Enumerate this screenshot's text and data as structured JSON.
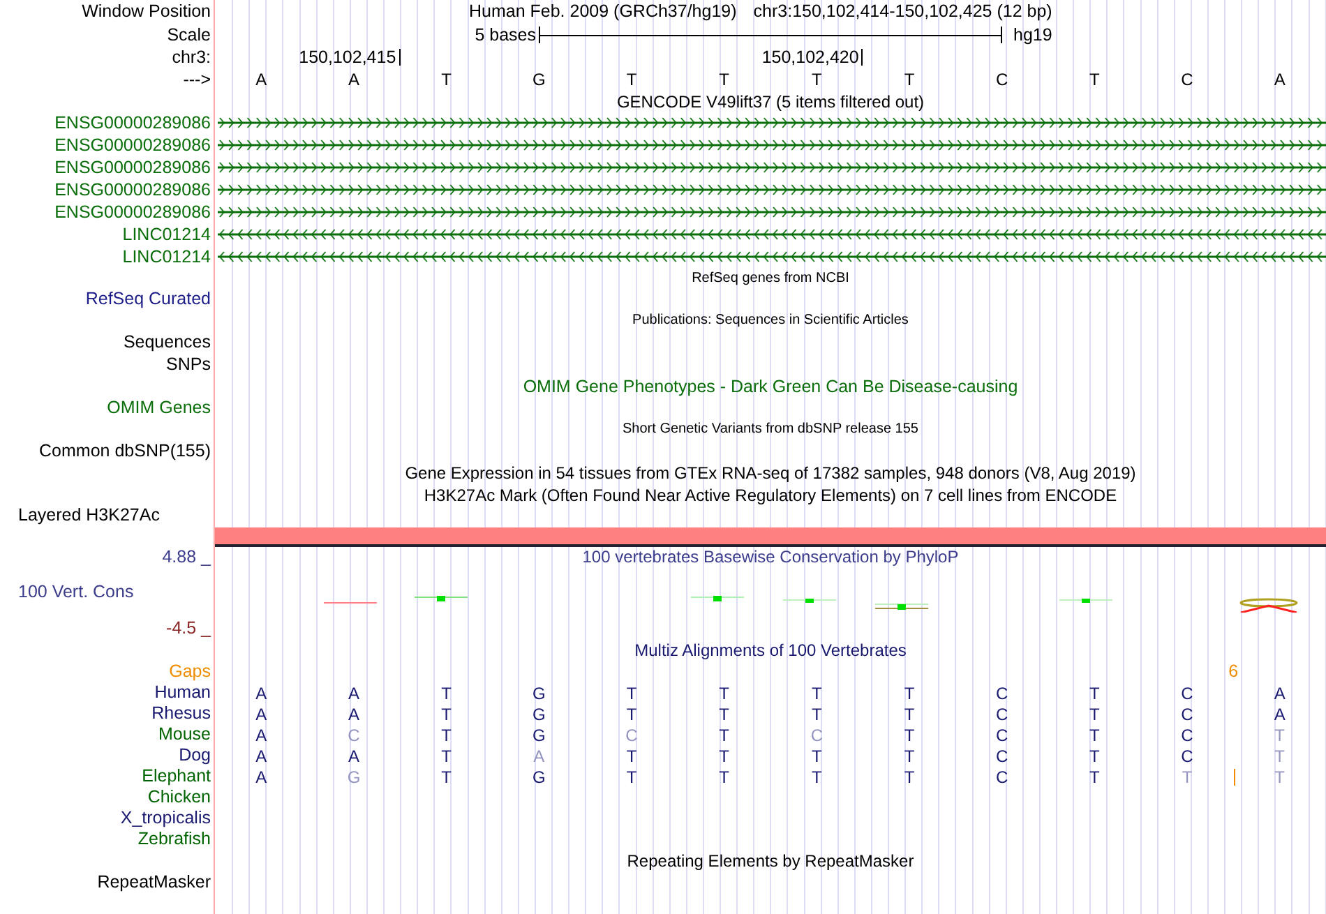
{
  "position": {
    "label": "Window Position",
    "assembly": "Human Feb. 2009 (GRCh37/hg19)",
    "range": "chr3:150,102,414-150,102,425 (12 bp)"
  },
  "scale": {
    "label": "Scale",
    "length": "5 bases",
    "assembly": "hg19"
  },
  "coordinates": {
    "label": "chr3:",
    "ticks": [
      "150,102,415",
      "150,102,420"
    ]
  },
  "sequence": {
    "label": "--->",
    "bases": [
      "A",
      "A",
      "T",
      "G",
      "T",
      "T",
      "T",
      "T",
      "C",
      "T",
      "C",
      "A"
    ]
  },
  "gencode": {
    "title": "GENCODE V49lift37 (5 items filtered out)",
    "genes": [
      {
        "name": "ENSG00000289086",
        "kind": "forward"
      },
      {
        "name": "ENSG00000289086",
        "kind": "forward"
      },
      {
        "name": "ENSG00000289086",
        "kind": "forward"
      },
      {
        "name": "ENSG00000289086",
        "kind": "forward"
      },
      {
        "name": "ENSG00000289086",
        "kind": "forward"
      },
      {
        "name": "LINC01214",
        "kind": "reverse"
      },
      {
        "name": "LINC01214",
        "kind": "reverse"
      }
    ]
  },
  "refseq": {
    "title": "RefSeq genes from NCBI",
    "label": "RefSeq Curated"
  },
  "publications": {
    "title": "Publications: Sequences in Scientific Articles",
    "labels": [
      "Sequences",
      "SNPs"
    ]
  },
  "omim": {
    "title": "OMIM Gene Phenotypes - Dark Green Can Be Disease-causing",
    "label": "OMIM Genes"
  },
  "dbsnp": {
    "title": "Short Genetic Variants from dbSNP release 155",
    "label": "Common dbSNP(155)"
  },
  "gtex": {
    "title": "Gene Expression in 54 tissues from GTEx RNA-seq of 17382 samples, 948 donors (V8, Aug 2019)"
  },
  "h3k27ac": {
    "title": "H3K27Ac Mark (Often Found Near Active Regulatory Elements) on 7 cell lines from ENCODE",
    "label": "Layered H3K27Ac"
  },
  "phylop": {
    "title": "100 vertebrates Basewise Conservation by PhyloP",
    "label": "100 Vert. Cons",
    "max": "4.88 _",
    "min": "-4.5 _"
  },
  "multiz": {
    "title": "Multiz Alignments of 100 Vertebrates",
    "gaps": {
      "label": "Gaps",
      "count": "6"
    },
    "species": [
      {
        "name": "Human",
        "color": "#191970",
        "insertion": false,
        "bases": [
          {
            "base": "A",
            "faded": false
          },
          {
            "base": "A",
            "faded": false
          },
          {
            "base": "T",
            "faded": false
          },
          {
            "base": "G",
            "faded": false
          },
          {
            "base": "T",
            "faded": false
          },
          {
            "base": "T",
            "faded": false
          },
          {
            "base": "T",
            "faded": false
          },
          {
            "base": "T",
            "faded": false
          },
          {
            "base": "C",
            "faded": false
          },
          {
            "base": "T",
            "faded": false
          },
          {
            "base": "C",
            "faded": false
          },
          {
            "base": "A",
            "faded": false
          }
        ]
      },
      {
        "name": "Rhesus",
        "color": "#191970",
        "insertion": false,
        "bases": [
          {
            "base": "A",
            "faded": false
          },
          {
            "base": "A",
            "faded": false
          },
          {
            "base": "T",
            "faded": false
          },
          {
            "base": "G",
            "faded": false
          },
          {
            "base": "T",
            "faded": false
          },
          {
            "base": "T",
            "faded": false
          },
          {
            "base": "T",
            "faded": false
          },
          {
            "base": "T",
            "faded": false
          },
          {
            "base": "C",
            "faded": false
          },
          {
            "base": "T",
            "faded": false
          },
          {
            "base": "C",
            "faded": false
          },
          {
            "base": "A",
            "faded": false
          }
        ]
      },
      {
        "name": "Mouse",
        "color": "#006400",
        "insertion": false,
        "bases": [
          {
            "base": "A",
            "faded": false
          },
          {
            "base": "C",
            "faded": true
          },
          {
            "base": "T",
            "faded": false
          },
          {
            "base": "G",
            "faded": false
          },
          {
            "base": "C",
            "faded": true
          },
          {
            "base": "T",
            "faded": false
          },
          {
            "base": "C",
            "faded": true
          },
          {
            "base": "T",
            "faded": false
          },
          {
            "base": "C",
            "faded": false
          },
          {
            "base": "T",
            "faded": false
          },
          {
            "base": "C",
            "faded": false
          },
          {
            "base": "T",
            "faded": true
          }
        ]
      },
      {
        "name": "Dog",
        "color": "#191970",
        "insertion": false,
        "bases": [
          {
            "base": "A",
            "faded": false
          },
          {
            "base": "A",
            "faded": false
          },
          {
            "base": "T",
            "faded": false
          },
          {
            "base": "A",
            "faded": true
          },
          {
            "base": "T",
            "faded": false
          },
          {
            "base": "T",
            "faded": false
          },
          {
            "base": "T",
            "faded": false
          },
          {
            "base": "T",
            "faded": false
          },
          {
            "base": "C",
            "faded": false
          },
          {
            "base": "T",
            "faded": false
          },
          {
            "base": "C",
            "faded": false
          },
          {
            "base": "T",
            "faded": true
          }
        ]
      },
      {
        "name": "Elephant",
        "color": "#006400",
        "insertion": true,
        "bases": [
          {
            "base": "A",
            "faded": false
          },
          {
            "base": "G",
            "faded": true
          },
          {
            "base": "T",
            "faded": false
          },
          {
            "base": "G",
            "faded": false
          },
          {
            "base": "T",
            "faded": false
          },
          {
            "base": "T",
            "faded": false
          },
          {
            "base": "T",
            "faded": false
          },
          {
            "base": "T",
            "faded": false
          },
          {
            "base": "C",
            "faded": false
          },
          {
            "base": "T",
            "faded": false
          },
          {
            "base": "T",
            "faded": true
          },
          {
            "base": "T",
            "faded": true
          }
        ]
      },
      {
        "name": "Chicken",
        "color": "#006400",
        "insertion": false
      },
      {
        "name": "X_tropicalis",
        "color": "#191970",
        "insertion": false
      },
      {
        "name": "Zebrafish",
        "color": "#006400",
        "insertion": false
      }
    ]
  },
  "repeatmasker": {
    "title": "Repeating Elements by RepeatMasker",
    "label": "RepeatMasker"
  }
}
